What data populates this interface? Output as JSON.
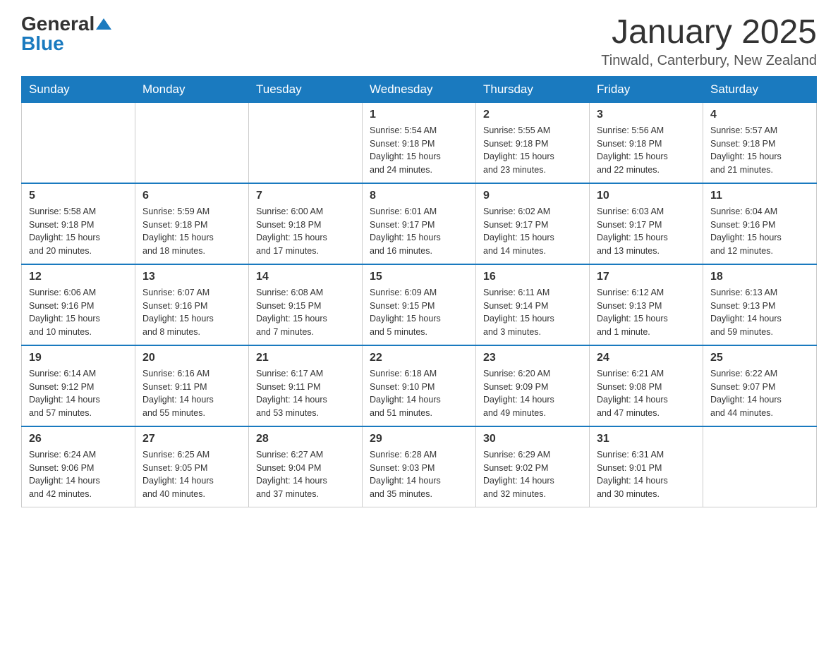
{
  "header": {
    "logo_text_general": "General",
    "logo_text_blue": "Blue",
    "month_title": "January 2025",
    "location": "Tinwald, Canterbury, New Zealand"
  },
  "calendar": {
    "days_of_week": [
      "Sunday",
      "Monday",
      "Tuesday",
      "Wednesday",
      "Thursday",
      "Friday",
      "Saturday"
    ],
    "weeks": [
      [
        {
          "day": "",
          "info": ""
        },
        {
          "day": "",
          "info": ""
        },
        {
          "day": "",
          "info": ""
        },
        {
          "day": "1",
          "info": "Sunrise: 5:54 AM\nSunset: 9:18 PM\nDaylight: 15 hours\nand 24 minutes."
        },
        {
          "day": "2",
          "info": "Sunrise: 5:55 AM\nSunset: 9:18 PM\nDaylight: 15 hours\nand 23 minutes."
        },
        {
          "day": "3",
          "info": "Sunrise: 5:56 AM\nSunset: 9:18 PM\nDaylight: 15 hours\nand 22 minutes."
        },
        {
          "day": "4",
          "info": "Sunrise: 5:57 AM\nSunset: 9:18 PM\nDaylight: 15 hours\nand 21 minutes."
        }
      ],
      [
        {
          "day": "5",
          "info": "Sunrise: 5:58 AM\nSunset: 9:18 PM\nDaylight: 15 hours\nand 20 minutes."
        },
        {
          "day": "6",
          "info": "Sunrise: 5:59 AM\nSunset: 9:18 PM\nDaylight: 15 hours\nand 18 minutes."
        },
        {
          "day": "7",
          "info": "Sunrise: 6:00 AM\nSunset: 9:18 PM\nDaylight: 15 hours\nand 17 minutes."
        },
        {
          "day": "8",
          "info": "Sunrise: 6:01 AM\nSunset: 9:17 PM\nDaylight: 15 hours\nand 16 minutes."
        },
        {
          "day": "9",
          "info": "Sunrise: 6:02 AM\nSunset: 9:17 PM\nDaylight: 15 hours\nand 14 minutes."
        },
        {
          "day": "10",
          "info": "Sunrise: 6:03 AM\nSunset: 9:17 PM\nDaylight: 15 hours\nand 13 minutes."
        },
        {
          "day": "11",
          "info": "Sunrise: 6:04 AM\nSunset: 9:16 PM\nDaylight: 15 hours\nand 12 minutes."
        }
      ],
      [
        {
          "day": "12",
          "info": "Sunrise: 6:06 AM\nSunset: 9:16 PM\nDaylight: 15 hours\nand 10 minutes."
        },
        {
          "day": "13",
          "info": "Sunrise: 6:07 AM\nSunset: 9:16 PM\nDaylight: 15 hours\nand 8 minutes."
        },
        {
          "day": "14",
          "info": "Sunrise: 6:08 AM\nSunset: 9:15 PM\nDaylight: 15 hours\nand 7 minutes."
        },
        {
          "day": "15",
          "info": "Sunrise: 6:09 AM\nSunset: 9:15 PM\nDaylight: 15 hours\nand 5 minutes."
        },
        {
          "day": "16",
          "info": "Sunrise: 6:11 AM\nSunset: 9:14 PM\nDaylight: 15 hours\nand 3 minutes."
        },
        {
          "day": "17",
          "info": "Sunrise: 6:12 AM\nSunset: 9:13 PM\nDaylight: 15 hours\nand 1 minute."
        },
        {
          "day": "18",
          "info": "Sunrise: 6:13 AM\nSunset: 9:13 PM\nDaylight: 14 hours\nand 59 minutes."
        }
      ],
      [
        {
          "day": "19",
          "info": "Sunrise: 6:14 AM\nSunset: 9:12 PM\nDaylight: 14 hours\nand 57 minutes."
        },
        {
          "day": "20",
          "info": "Sunrise: 6:16 AM\nSunset: 9:11 PM\nDaylight: 14 hours\nand 55 minutes."
        },
        {
          "day": "21",
          "info": "Sunrise: 6:17 AM\nSunset: 9:11 PM\nDaylight: 14 hours\nand 53 minutes."
        },
        {
          "day": "22",
          "info": "Sunrise: 6:18 AM\nSunset: 9:10 PM\nDaylight: 14 hours\nand 51 minutes."
        },
        {
          "day": "23",
          "info": "Sunrise: 6:20 AM\nSunset: 9:09 PM\nDaylight: 14 hours\nand 49 minutes."
        },
        {
          "day": "24",
          "info": "Sunrise: 6:21 AM\nSunset: 9:08 PM\nDaylight: 14 hours\nand 47 minutes."
        },
        {
          "day": "25",
          "info": "Sunrise: 6:22 AM\nSunset: 9:07 PM\nDaylight: 14 hours\nand 44 minutes."
        }
      ],
      [
        {
          "day": "26",
          "info": "Sunrise: 6:24 AM\nSunset: 9:06 PM\nDaylight: 14 hours\nand 42 minutes."
        },
        {
          "day": "27",
          "info": "Sunrise: 6:25 AM\nSunset: 9:05 PM\nDaylight: 14 hours\nand 40 minutes."
        },
        {
          "day": "28",
          "info": "Sunrise: 6:27 AM\nSunset: 9:04 PM\nDaylight: 14 hours\nand 37 minutes."
        },
        {
          "day": "29",
          "info": "Sunrise: 6:28 AM\nSunset: 9:03 PM\nDaylight: 14 hours\nand 35 minutes."
        },
        {
          "day": "30",
          "info": "Sunrise: 6:29 AM\nSunset: 9:02 PM\nDaylight: 14 hours\nand 32 minutes."
        },
        {
          "day": "31",
          "info": "Sunrise: 6:31 AM\nSunset: 9:01 PM\nDaylight: 14 hours\nand 30 minutes."
        },
        {
          "day": "",
          "info": ""
        }
      ]
    ]
  }
}
